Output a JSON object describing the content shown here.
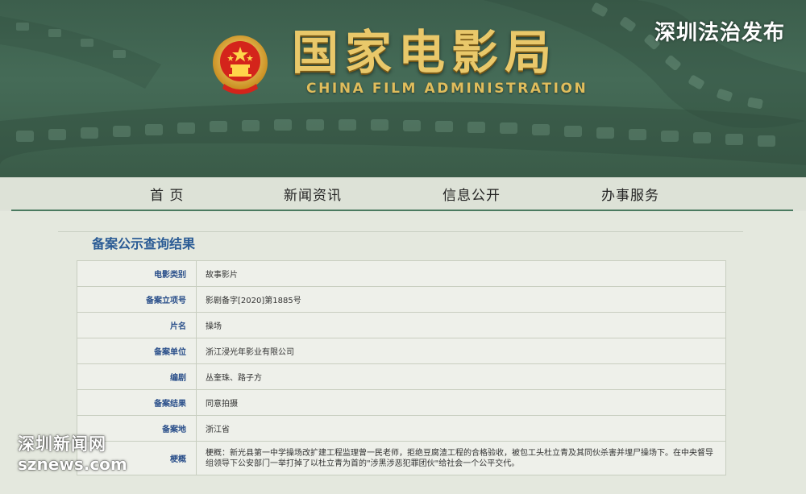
{
  "header": {
    "title": "国家电影局",
    "subtitle": "CHINA FILM ADMINISTRATION",
    "corner_watermark": "深圳法治发布"
  },
  "nav": {
    "items": [
      {
        "label": "首 页"
      },
      {
        "label": "新闻资讯"
      },
      {
        "label": "信息公开"
      },
      {
        "label": "办事服务"
      }
    ]
  },
  "section": {
    "title": "备案公示查询结果"
  },
  "record": {
    "rows": [
      {
        "label": "电影类别",
        "value": "故事影片"
      },
      {
        "label": "备案立项号",
        "value": "影剧备字[2020]第1885号"
      },
      {
        "label": "片名",
        "value": "操场"
      },
      {
        "label": "备案单位",
        "value": "浙江浸光年影业有限公司"
      },
      {
        "label": "编剧",
        "value": "丛奎珠、路子方"
      },
      {
        "label": "备案结果",
        "value": "同意拍摄"
      },
      {
        "label": "备案地",
        "value": "浙江省"
      },
      {
        "label": "梗概",
        "value": "梗概：新光县第一中学操场改扩建工程监理曾一民老师，拒绝豆腐渣工程的合格验收，被包工头杜立青及其同伙杀害并埋尸操场下。在中央督导组领导下公安部门一举打掉了以杜立青为首的\"涉黑涉恶犯罪团伙\"给社会一个公平交代。"
      }
    ]
  },
  "watermark": {
    "cn": "深圳新闻网",
    "en": "sznews.com"
  },
  "colors": {
    "banner_green": "#456b57",
    "gold": "#e9c86a",
    "nav_rule": "#4a7a60",
    "label_blue": "#2a4f8a",
    "title_blue": "#2a5b95"
  }
}
